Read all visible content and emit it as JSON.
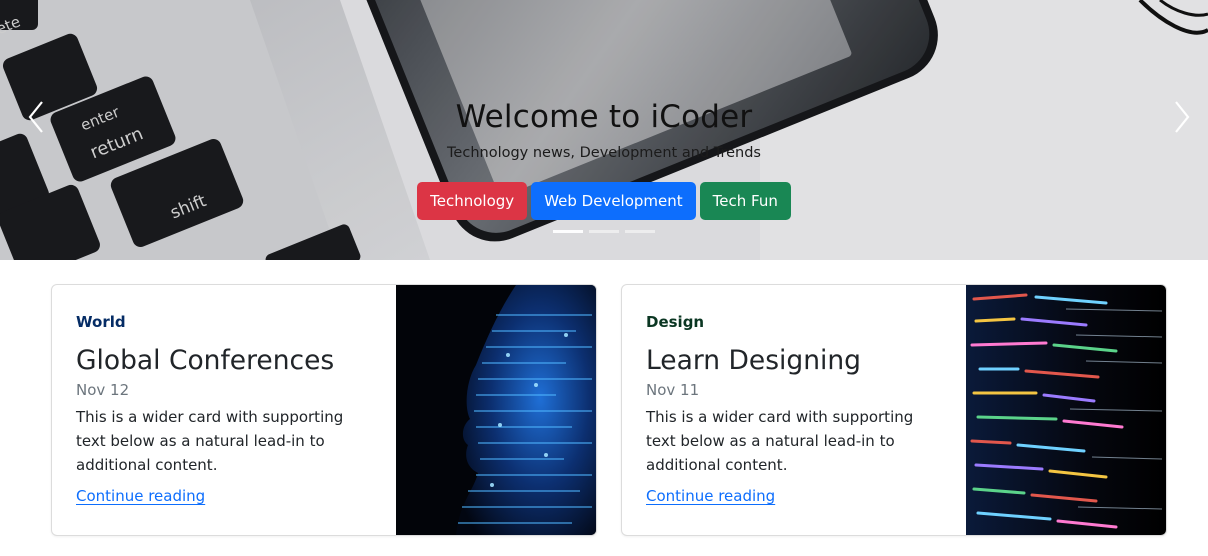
{
  "carousel": {
    "title": "Welcome to iCoder",
    "subtitle": "Technology news, Development and Trends",
    "buttons": [
      {
        "label": "Technology",
        "color": "#dc3545"
      },
      {
        "label": "Web Development",
        "color": "#0d6efd"
      },
      {
        "label": "Tech Fun",
        "color": "#198754"
      }
    ],
    "slide_count": 3,
    "active_slide": 1,
    "prev_icon": "chevron-left-icon",
    "next_icon": "chevron-right-icon"
  },
  "cards": [
    {
      "category": "World",
      "category_color": "#052c65",
      "title": "Global Conferences",
      "date": "Nov 12",
      "text": "This is a wider card with supporting text below as a natural lead-in to additional content.",
      "link": "Continue reading"
    },
    {
      "category": "Design",
      "category_color": "#0a3622",
      "title": "Learn Designing",
      "date": "Nov 11",
      "text": "This is a wider card with supporting text below as a natural lead-in to additional content.",
      "link": "Continue reading"
    }
  ],
  "colors": {
    "link": "#0d6efd",
    "muted": "#6c757d"
  }
}
